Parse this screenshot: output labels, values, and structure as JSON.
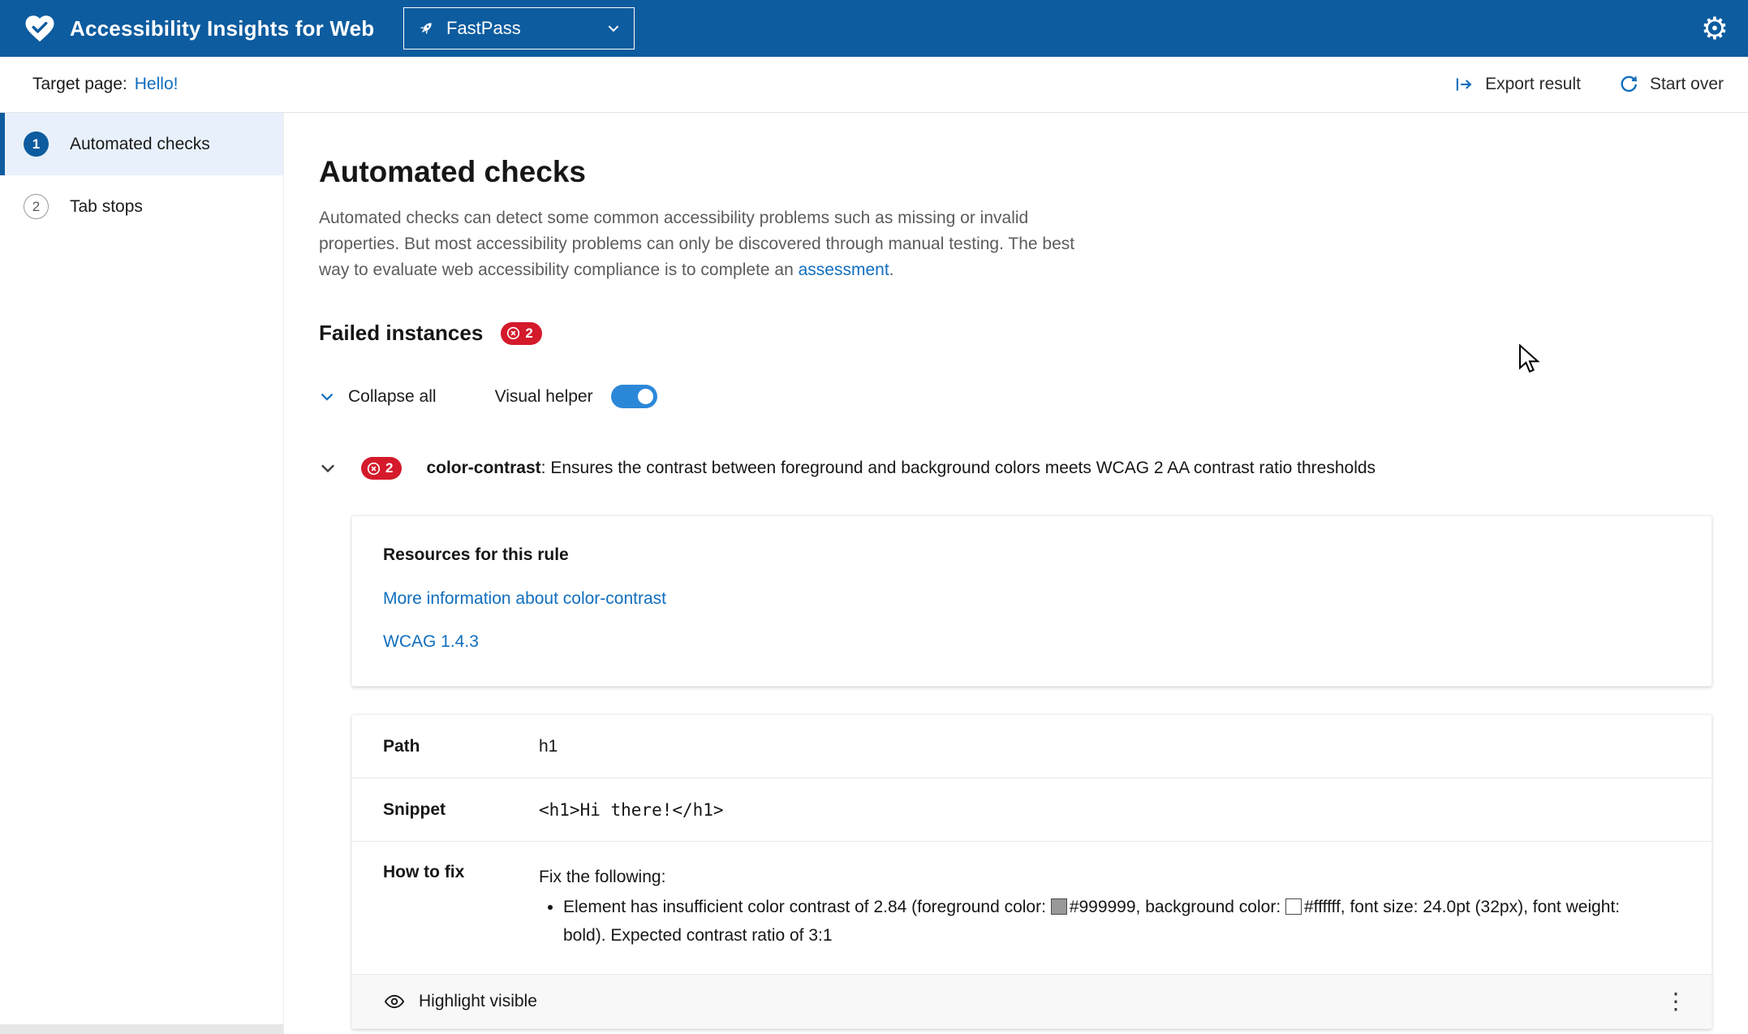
{
  "header": {
    "app_title": "Accessibility Insights for Web",
    "mode": "FastPass"
  },
  "subheader": {
    "target_label": "Target page:",
    "target_link": "Hello!",
    "export_label": "Export result",
    "start_over_label": "Start over"
  },
  "sidebar": {
    "items": [
      {
        "number": "1",
        "label": "Automated checks",
        "selected": true
      },
      {
        "number": "2",
        "label": "Tab stops",
        "selected": false
      }
    ]
  },
  "main": {
    "title": "Automated checks",
    "intro_text": "Automated checks can detect some common accessibility problems such as missing or invalid properties. But most accessibility problems can only be discovered through manual testing. The best way to evaluate web accessibility compliance is to complete an ",
    "intro_link": "assessment",
    "intro_period": ".",
    "failed_heading": "Failed instances",
    "failed_count": "2",
    "collapse_all": "Collapse all",
    "visual_helper": "Visual helper"
  },
  "rule": {
    "count": "2",
    "name": "color-contrast",
    "description": ": Ensures the contrast between foreground and background colors meets WCAG 2 AA contrast ratio thresholds"
  },
  "resources": {
    "title": "Resources for this rule",
    "link_more": "More information about color-contrast",
    "link_wcag": "WCAG 1.4.3"
  },
  "instance": {
    "path_label": "Path",
    "path_value": "h1",
    "snippet_label": "Snippet",
    "snippet_value": "<h1>Hi there!</h1>",
    "fix_label": "How to fix",
    "fix_intro": "Fix the following:",
    "fix_pre": "Element has insufficient color contrast of 2.84 (foreground color: ",
    "fix_fg": "#999999",
    "fix_mid": ", background color: ",
    "fix_bg": "#ffffff",
    "fix_post": ", font size: 24.0pt (32px), font weight: bold). Expected contrast ratio of 3:1",
    "highlight_label": "Highlight visible"
  },
  "colors": {
    "header_bg": "#0d5c9f",
    "accent_link": "#106ebe",
    "error": "#d41a2b",
    "toggle_on": "#2b88d8",
    "nav_selected_bg": "#e8f1fb",
    "swatch_fg": "#999999",
    "swatch_bg": "#ffffff"
  }
}
